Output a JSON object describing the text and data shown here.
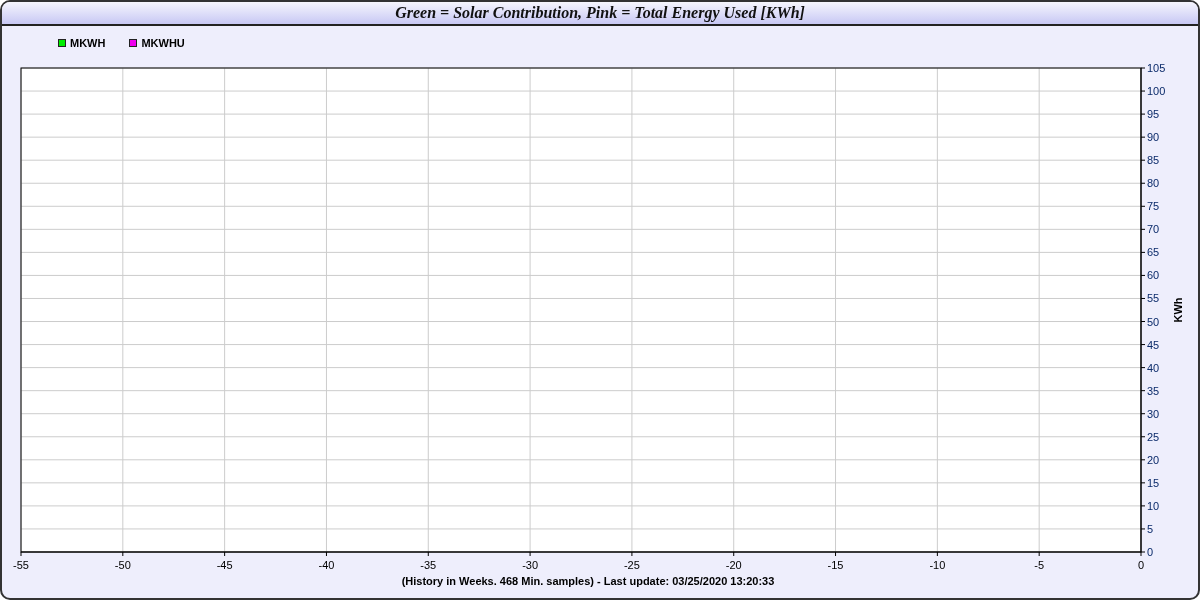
{
  "window": {
    "title": "Green = Solar Contribution, Pink = Total Energy Used [KWh]"
  },
  "chart_data": {
    "type": "line",
    "xlabel": "(History in Weeks. 468 Min. samples) - Last update: 03/25/2020 13:20:33",
    "ylabel": "KWh",
    "categories": [
      "-55",
      "-50",
      "-45",
      "-40",
      "-35",
      "-30",
      "-25",
      "-20",
      "-15",
      "-10",
      "-5",
      "0"
    ],
    "series": [
      {
        "name": "MKWH",
        "color": "#00ee00",
        "values": [
          null,
          null,
          null,
          null,
          null,
          null,
          null,
          null,
          null,
          null,
          null,
          null
        ]
      },
      {
        "name": "MKWHU",
        "color": "#ee00ee",
        "values": [
          null,
          null,
          null,
          null,
          null,
          null,
          null,
          null,
          null,
          null,
          null,
          null
        ]
      }
    ],
    "ylim": [
      0,
      105
    ],
    "grid": true,
    "yticks": [
      0,
      5,
      10,
      15,
      20,
      25,
      30,
      35,
      40,
      45,
      50,
      55,
      60,
      65,
      70,
      75,
      80,
      85,
      90,
      95,
      100,
      105
    ]
  }
}
